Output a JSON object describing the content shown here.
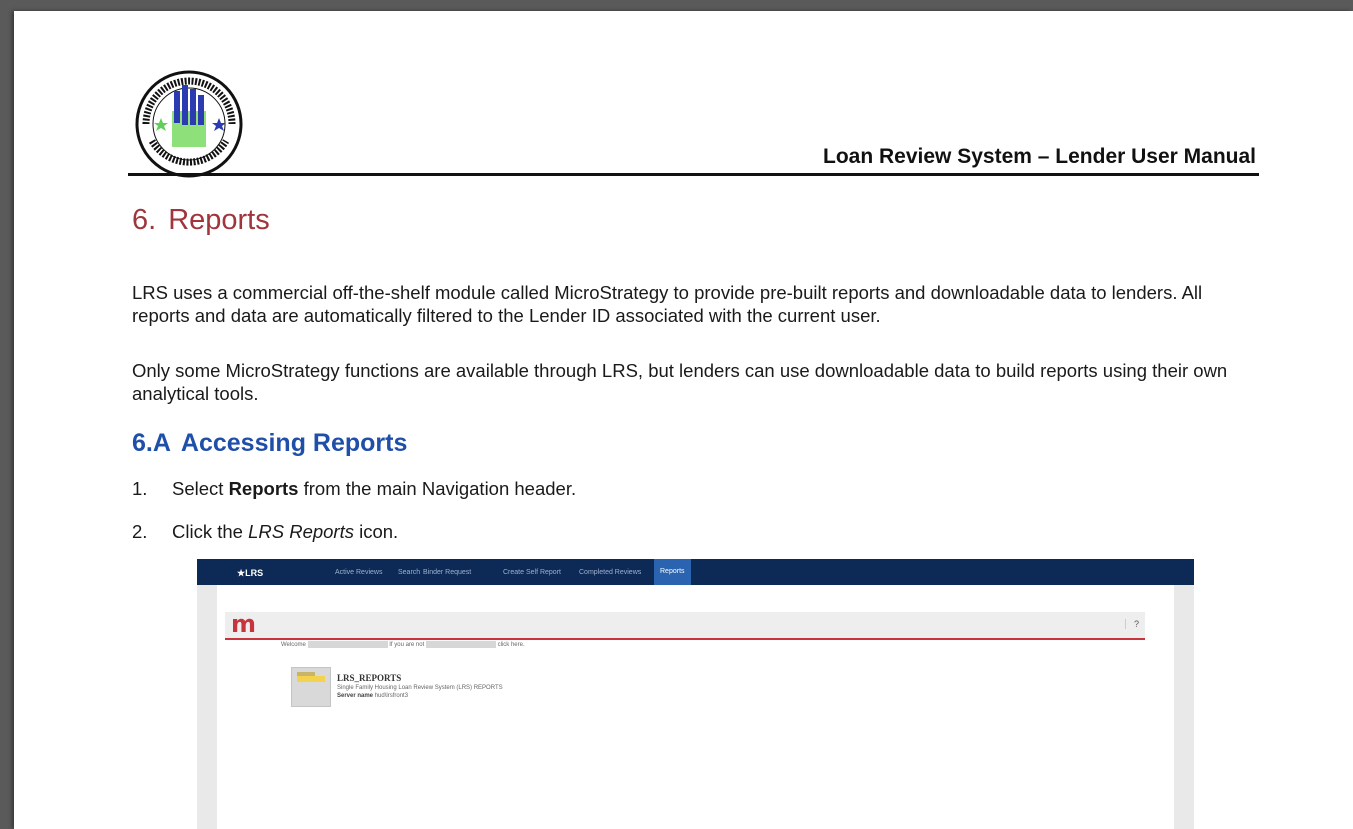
{
  "header": {
    "title": "Loan Review System – Lender User Manual"
  },
  "section": {
    "number": "6.",
    "title": "Reports"
  },
  "paragraphs": [
    "LRS uses a commercial off-the-shelf module called MicroStrategy to provide pre-built reports and downloadable data to lenders. All reports and data are automatically filtered to the Lender ID associated with the current user.",
    "Only some MicroStrategy functions are available through LRS, but lenders can use downloadable data to build reports using their own analytical tools."
  ],
  "subsection": {
    "number": "6.A",
    "title": "Accessing Reports"
  },
  "steps": [
    {
      "n": "1.",
      "pre": "Select ",
      "bold": "Reports",
      "post": " from the main Navigation header."
    },
    {
      "n": "2.",
      "pre": "Click the ",
      "italic": "LRS Reports",
      "post": " icon."
    }
  ],
  "screenshot": {
    "brand": "★LRS",
    "nav_items": [
      "Active Reviews",
      "Search",
      "Binder Request",
      "Create Self Report",
      "Completed Reviews"
    ],
    "nav_active": "Reports",
    "ms_logo": "m",
    "help": "?",
    "welcome": "Welcome",
    "not_you": "If you are not",
    "click_here": "click here.",
    "report_title": "LRS_REPORTS",
    "report_desc": "Single Family Housing Loan Review System (LRS) REPORTS",
    "server_label": "Server name",
    "server_value": "hud\\lrsfront3"
  }
}
